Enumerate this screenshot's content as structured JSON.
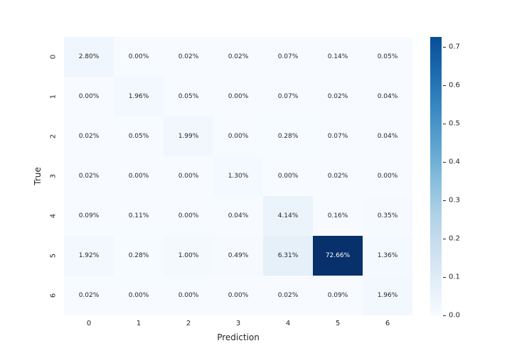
{
  "chart_data": {
    "type": "heatmap",
    "xlabel": "Prediction",
    "ylabel": "True",
    "x_categories": [
      "0",
      "1",
      "2",
      "3",
      "4",
      "5",
      "6"
    ],
    "y_categories": [
      "0",
      "1",
      "2",
      "3",
      "4",
      "5",
      "6"
    ],
    "values": [
      [
        0.028,
        0.0,
        0.0002,
        0.0002,
        0.0007,
        0.0014,
        0.0005
      ],
      [
        0.0,
        0.0196,
        0.0005,
        0.0,
        0.0007,
        0.0002,
        0.0004
      ],
      [
        0.0002,
        0.0005,
        0.0199,
        0.0,
        0.0028,
        0.0007,
        0.0004
      ],
      [
        0.0002,
        0.0,
        0.0,
        0.013,
        0.0,
        0.0002,
        0.0
      ],
      [
        0.0009,
        0.0011,
        0.0,
        0.0004,
        0.0414,
        0.0016,
        0.0035
      ],
      [
        0.0192,
        0.0028,
        0.01,
        0.0049,
        0.0631,
        0.7266,
        0.0136
      ],
      [
        0.0002,
        0.0,
        0.0,
        0.0,
        0.0002,
        0.0009,
        0.0196
      ]
    ],
    "annotations": [
      [
        "2.80%",
        "0.00%",
        "0.02%",
        "0.02%",
        "0.07%",
        "0.14%",
        "0.05%"
      ],
      [
        "0.00%",
        "1.96%",
        "0.05%",
        "0.00%",
        "0.07%",
        "0.02%",
        "0.04%"
      ],
      [
        "0.02%",
        "0.05%",
        "1.99%",
        "0.00%",
        "0.28%",
        "0.07%",
        "0.04%"
      ],
      [
        "0.02%",
        "0.00%",
        "0.00%",
        "1.30%",
        "0.00%",
        "0.02%",
        "0.00%"
      ],
      [
        "0.09%",
        "0.11%",
        "0.00%",
        "0.04%",
        "4.14%",
        "0.16%",
        "0.35%"
      ],
      [
        "1.92%",
        "0.28%",
        "1.00%",
        "0.49%",
        "6.31%",
        "72.66%",
        "1.36%"
      ],
      [
        "0.02%",
        "0.00%",
        "0.00%",
        "0.00%",
        "0.02%",
        "0.09%",
        "1.96%"
      ]
    ],
    "colorbar": {
      "vmin": 0.0,
      "vmax": 0.7266,
      "ticks": [
        0.0,
        0.1,
        0.2,
        0.3,
        0.4,
        0.5,
        0.6,
        0.7
      ],
      "tick_labels": [
        "0.0",
        "0.1",
        "0.2",
        "0.3",
        "0.4",
        "0.5",
        "0.6",
        "0.7"
      ]
    }
  }
}
